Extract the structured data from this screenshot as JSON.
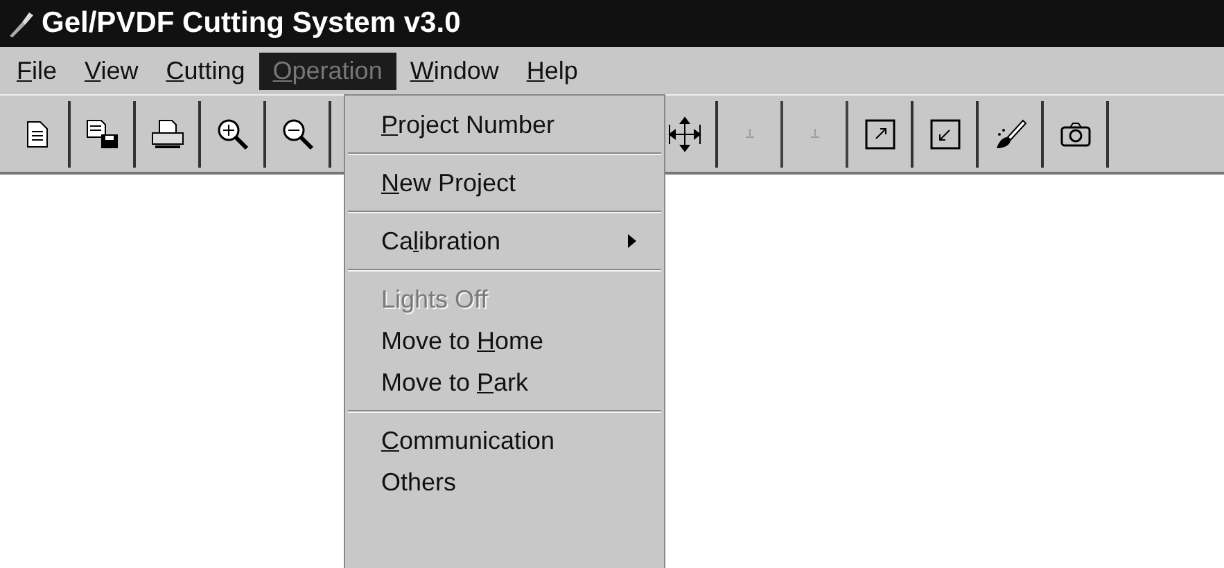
{
  "window": {
    "title": "Gel/PVDF Cutting System v3.0"
  },
  "menubar": [
    {
      "label": {
        "key": "F",
        "post": "ile"
      },
      "selected": false
    },
    {
      "label": {
        "key": "V",
        "post": "iew"
      },
      "selected": false
    },
    {
      "label": {
        "key": "C",
        "post": "utting"
      },
      "selected": false
    },
    {
      "label": {
        "key": "O",
        "post": "peration"
      },
      "selected": true
    },
    {
      "label": {
        "key": "W",
        "post": "indow"
      },
      "selected": false
    },
    {
      "label": {
        "key": "H",
        "post": "elp"
      },
      "selected": false
    }
  ],
  "toolbar": [
    {
      "kind": "document",
      "disabled": false
    },
    {
      "kind": "save",
      "disabled": false
    },
    {
      "kind": "print",
      "disabled": false
    },
    {
      "kind": "zoom-in",
      "disabled": false
    },
    {
      "kind": "zoom-out",
      "disabled": false
    },
    {
      "kind": "gap"
    },
    {
      "kind": "move",
      "disabled": false
    },
    {
      "kind": "dot",
      "disabled": true
    },
    {
      "kind": "dot",
      "disabled": true
    },
    {
      "kind": "expand",
      "disabled": false
    },
    {
      "kind": "shrink",
      "disabled": false
    },
    {
      "kind": "brush",
      "disabled": false
    },
    {
      "kind": "camera",
      "disabled": false
    }
  ],
  "dropdown": [
    {
      "kind": "item",
      "label": {
        "key": "P",
        "post": "roject Number"
      },
      "disabled": false
    },
    {
      "kind": "separator"
    },
    {
      "kind": "item",
      "label": {
        "key": "N",
        "post": "ew Project"
      },
      "disabled": false
    },
    {
      "kind": "separator"
    },
    {
      "kind": "submenu",
      "label": {
        "pre": "Ca",
        "key": "l",
        "post": "ibration"
      },
      "disabled": false
    },
    {
      "kind": "separator"
    },
    {
      "kind": "item",
      "label": {
        "pre": "Lights Off"
      },
      "disabled": true
    },
    {
      "kind": "item",
      "label": {
        "pre": "Move to ",
        "key": "H",
        "post": "ome"
      },
      "disabled": false
    },
    {
      "kind": "item",
      "label": {
        "pre": "Move to ",
        "key": "P",
        "post": "ark"
      },
      "disabled": false
    },
    {
      "kind": "separator"
    },
    {
      "kind": "item",
      "label": {
        "key": "C",
        "post": "ommunication"
      },
      "disabled": false
    },
    {
      "kind": "item",
      "label": {
        "pre": "Others"
      },
      "disabled": false
    }
  ]
}
